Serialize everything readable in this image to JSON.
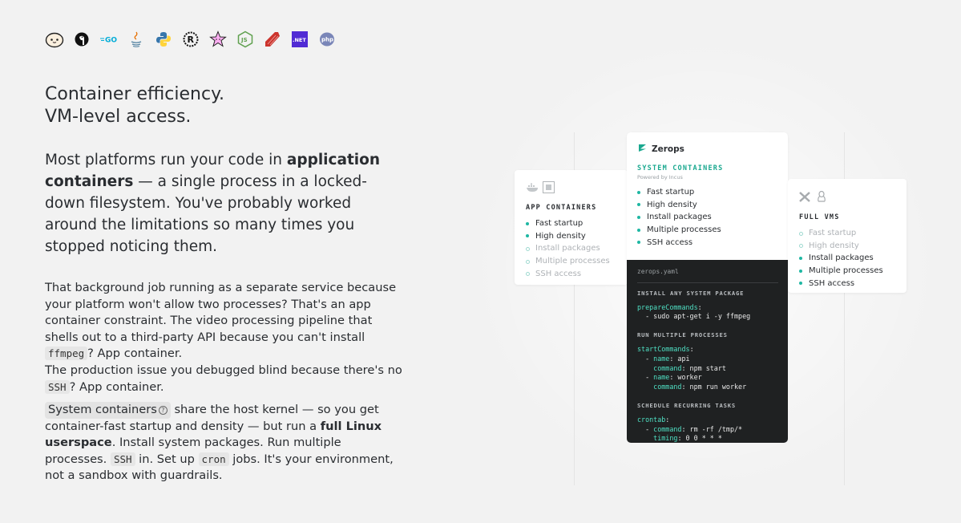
{
  "language_icons": [
    {
      "name": "bun-icon"
    },
    {
      "name": "deno-icon"
    },
    {
      "name": "go-icon",
      "text": "=GO"
    },
    {
      "name": "java-icon"
    },
    {
      "name": "python-icon"
    },
    {
      "name": "rust-icon",
      "text": "R"
    },
    {
      "name": "gleam-icon"
    },
    {
      "name": "nodejs-icon",
      "text": "JS"
    },
    {
      "name": "ruby-icon"
    },
    {
      "name": "dotnet-icon",
      "text": ".NET"
    },
    {
      "name": "php-icon",
      "text": "php"
    }
  ],
  "heading": {
    "line1": "Container efficiency.",
    "line2": "VM-level access."
  },
  "lead": {
    "part1": "Most platforms run your code in ",
    "bold": "application containers",
    "part2": " — a single process in a locked-down filesystem. You've probably worked around the limitations so many times you stopped noticing them."
  },
  "para2": {
    "t1": "That background job running as a separate service because your platform won't allow two processes? That's an app container constraint. The video processing pipeline that shells out to a third-party API because you can't install ",
    "code1": "ffmpeg",
    "t2": "? App container.",
    "t3": "The production issue you debugged blind because there's no ",
    "code2": "SSH",
    "t4": "? App container."
  },
  "para3": {
    "pill": "System containers",
    "help_icon": "?",
    "t1": " share the host kernel — so you get container-fast startup and density — but run a ",
    "bold": "full Linux userspace",
    "t2": ". Install system packages. Run multiple processes. ",
    "code1": "SSH",
    "t3": " in. Set up ",
    "code2": "cron",
    "t4": " jobs. It's your environment, not a sandbox with guardrails."
  },
  "cards": {
    "app": {
      "title": "APP CONTAINERS",
      "features": [
        {
          "label": "Fast startup",
          "on": true
        },
        {
          "label": "High density",
          "on": true
        },
        {
          "label": "Install packages",
          "on": false
        },
        {
          "label": "Multiple processes",
          "on": false
        },
        {
          "label": "SSH access",
          "on": false
        }
      ]
    },
    "system": {
      "brand": "Zerops",
      "title": "SYSTEM CONTAINERS",
      "powered_by": "Powered by Incus",
      "features": [
        {
          "label": "Fast startup",
          "on": true
        },
        {
          "label": "High density",
          "on": true
        },
        {
          "label": "Install packages",
          "on": true
        },
        {
          "label": "Multiple processes",
          "on": true
        },
        {
          "label": "SSH access",
          "on": true
        }
      ]
    },
    "vm": {
      "title": "FULL VMS",
      "features": [
        {
          "label": "Fast startup",
          "on": false
        },
        {
          "label": "High density",
          "on": false
        },
        {
          "label": "Install packages",
          "on": true
        },
        {
          "label": "Multiple processes",
          "on": true
        },
        {
          "label": "SSH access",
          "on": true
        }
      ]
    }
  },
  "code": {
    "filename": "zerops.yaml",
    "sections": [
      {
        "title": "INSTALL ANY SYSTEM PACKAGE",
        "lines": [
          {
            "key": "prepareCommands",
            "rest": ":"
          },
          {
            "indent": "  - ",
            "key": "",
            "rest": "sudo apt-get i -y ffmpeg"
          }
        ]
      },
      {
        "title": "RUN MULTIPLE PROCESSES",
        "lines": [
          {
            "key": "startCommands",
            "rest": ":"
          },
          {
            "indent": "  - ",
            "key": "name",
            "rest": ": api"
          },
          {
            "indent": "    ",
            "key": "command",
            "rest": ": npm start"
          },
          {
            "indent": "  - ",
            "key": "name",
            "rest": ": worker"
          },
          {
            "indent": "    ",
            "key": "command",
            "rest": ": npm run worker"
          }
        ]
      },
      {
        "title": "SCHEDULE RECURRING TASKS",
        "lines": [
          {
            "key": "crontab",
            "rest": ":"
          },
          {
            "indent": "  - ",
            "key": "command",
            "rest": ": rm -rf /tmp/*"
          },
          {
            "indent": "    ",
            "key": "timing",
            "rest": ": 0 0 * * *"
          }
        ]
      }
    ]
  },
  "colors": {
    "accent": "#1fb7a3",
    "code_bg": "#1f2122",
    "background": "#f2f2f2"
  }
}
